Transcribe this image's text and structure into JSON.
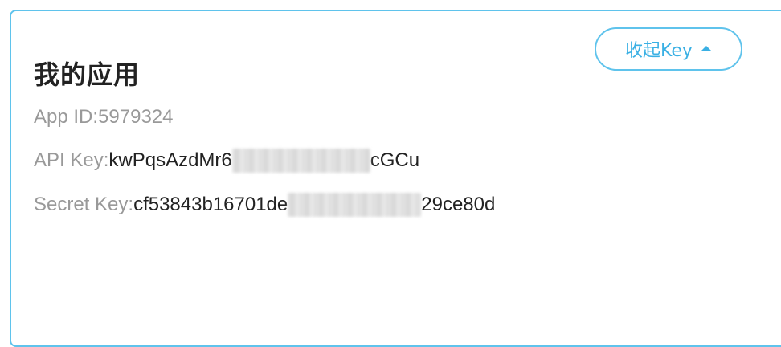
{
  "app_panel": {
    "title": "我的应用",
    "collapse_button_label": "收起Key",
    "app_id_label": "App ID: ",
    "app_id_value": "5979324",
    "api_key_label": "API Key: ",
    "api_key_prefix": "kwPqsAzdMr6",
    "api_key_suffix": "cGCu",
    "secret_key_label": "Secret Key: ",
    "secret_key_prefix": "cf53843b16701de",
    "secret_key_suffix": "29ce80d"
  },
  "colors": {
    "accent": "#5fc3ec",
    "button_text": "#3ab0e4",
    "label_gray": "#999999",
    "text_dark": "#222222"
  },
  "icons": {
    "collapse": "caret-up-icon"
  }
}
